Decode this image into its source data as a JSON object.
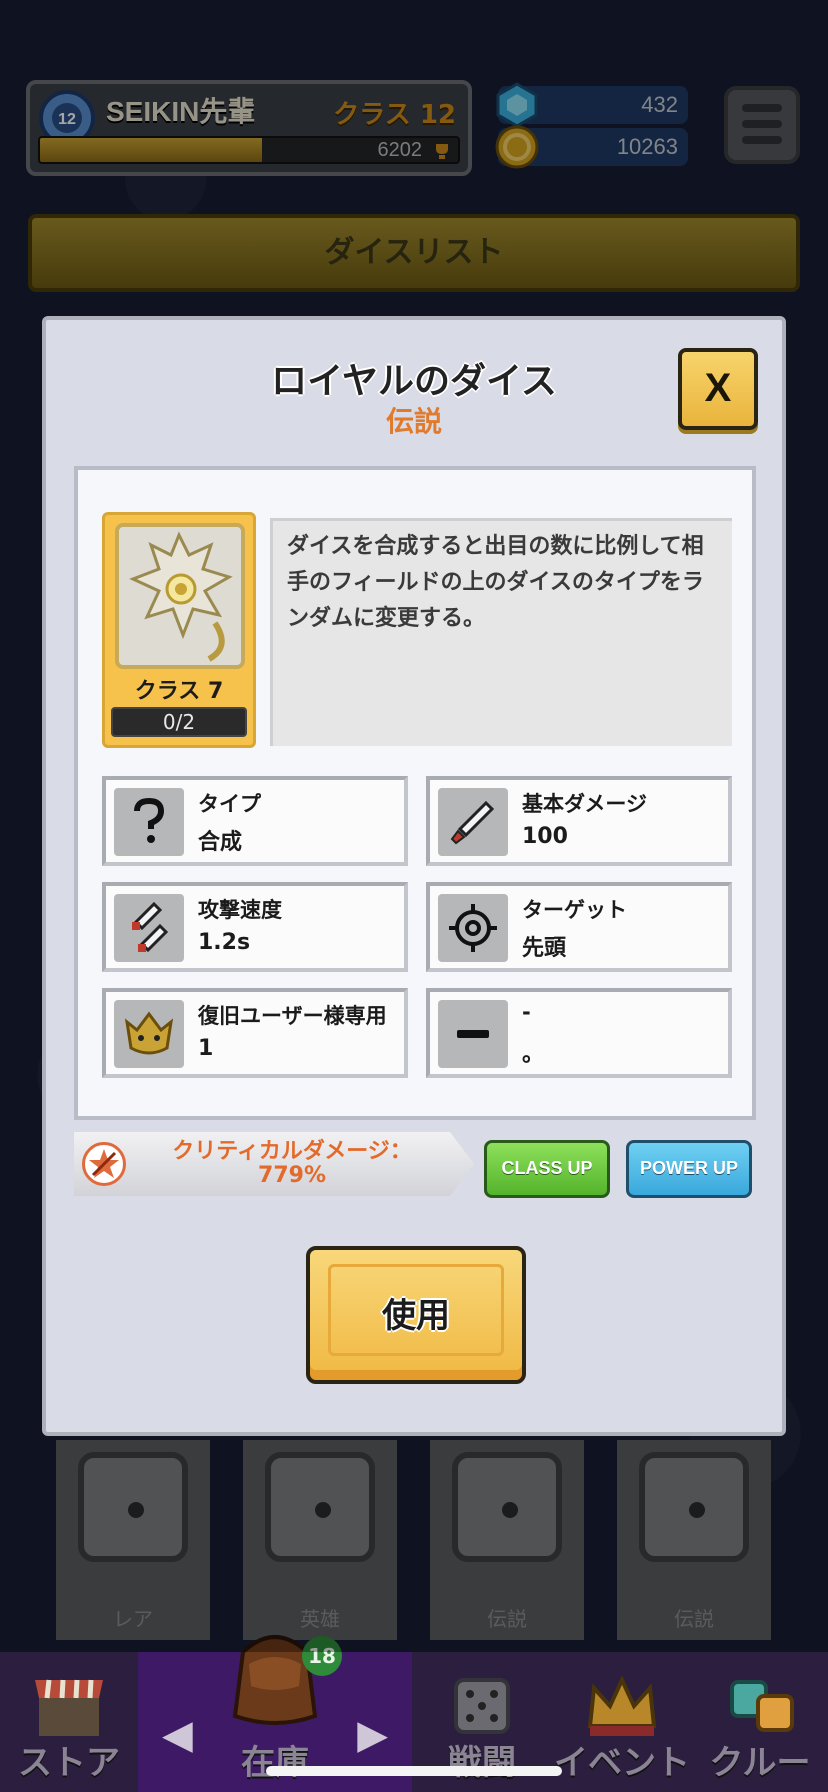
{
  "header": {
    "player_name": "SEIKIN先輩",
    "player_class": "クラス 12",
    "rank_level": "12",
    "xp_value": "6202",
    "xp_progress": 0.53,
    "gems": "432",
    "coins": "10263"
  },
  "dice_list": {
    "title": "ダイスリスト"
  },
  "modal": {
    "title": "ロイヤルのダイス",
    "rarity": "伝説",
    "close_label": "X",
    "portrait_class": "クラス 7",
    "portrait_count": "0/2",
    "description": "ダイスを合成すると出目の数に比例して相手のフィールドの上のダイスのタイプをランダムに変更する。",
    "stats": [
      {
        "label": "タイプ",
        "value": "合成",
        "icon": "question-icon"
      },
      {
        "label": "基本ダメージ",
        "value": "100",
        "icon": "sword-icon"
      },
      {
        "label": "攻撃速度",
        "value": "1.2s",
        "icon": "double-sword-icon"
      },
      {
        "label": "ターゲット",
        "value": "先頭",
        "icon": "crosshair-icon"
      },
      {
        "label": "復旧ユーザー様専用",
        "value": "1",
        "icon": "crown-beast-icon"
      },
      {
        "label": "-",
        "value": "。",
        "icon": "minus-icon"
      }
    ],
    "critical_text": "クリティカルダメージ：779%",
    "class_up_label": "CLASS UP",
    "power_up_label": "POWER UP",
    "use_label": "使用"
  },
  "dice_row": [
    {
      "label": "レア"
    },
    {
      "label": "英雄"
    },
    {
      "label": "伝説"
    },
    {
      "label": "伝説"
    }
  ],
  "bottom_nav": {
    "store": "ストア",
    "inventory": "在庫",
    "inventory_badge": "18",
    "battle": "戦闘",
    "event": "イベント",
    "crew": "クルー"
  },
  "colors": {
    "rarity": "#e07a2c",
    "class_up": "#54b32c",
    "power_up": "#3aa8dc",
    "use_button": "#f0b842"
  }
}
